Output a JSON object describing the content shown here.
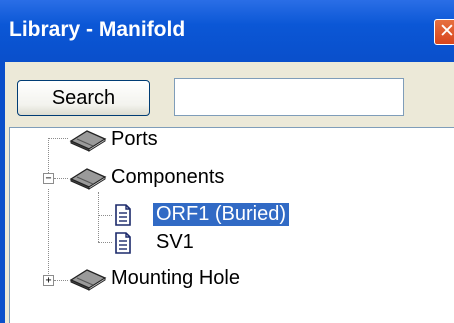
{
  "window": {
    "title": "Library - Manifold",
    "close_glyph": "✕"
  },
  "toolbar": {
    "search_label": "Search",
    "search_value": "",
    "search_placeholder": ""
  },
  "tree": {
    "items": [
      {
        "label": "Ports",
        "icon": "book-icon"
      },
      {
        "label": "Components",
        "icon": "book-icon",
        "expander": "−"
      },
      {
        "label": "ORF1 (Buried)",
        "icon": "document-icon",
        "selected": true
      },
      {
        "label": "SV1",
        "icon": "document-icon"
      },
      {
        "label": "Mounting Hole",
        "icon": "book-icon",
        "expander": "+"
      }
    ]
  },
  "colors": {
    "titlebar": "#0a4fcb",
    "selection": "#316ac5",
    "panel": "#ece9d8",
    "close_button": "#d8451d"
  }
}
